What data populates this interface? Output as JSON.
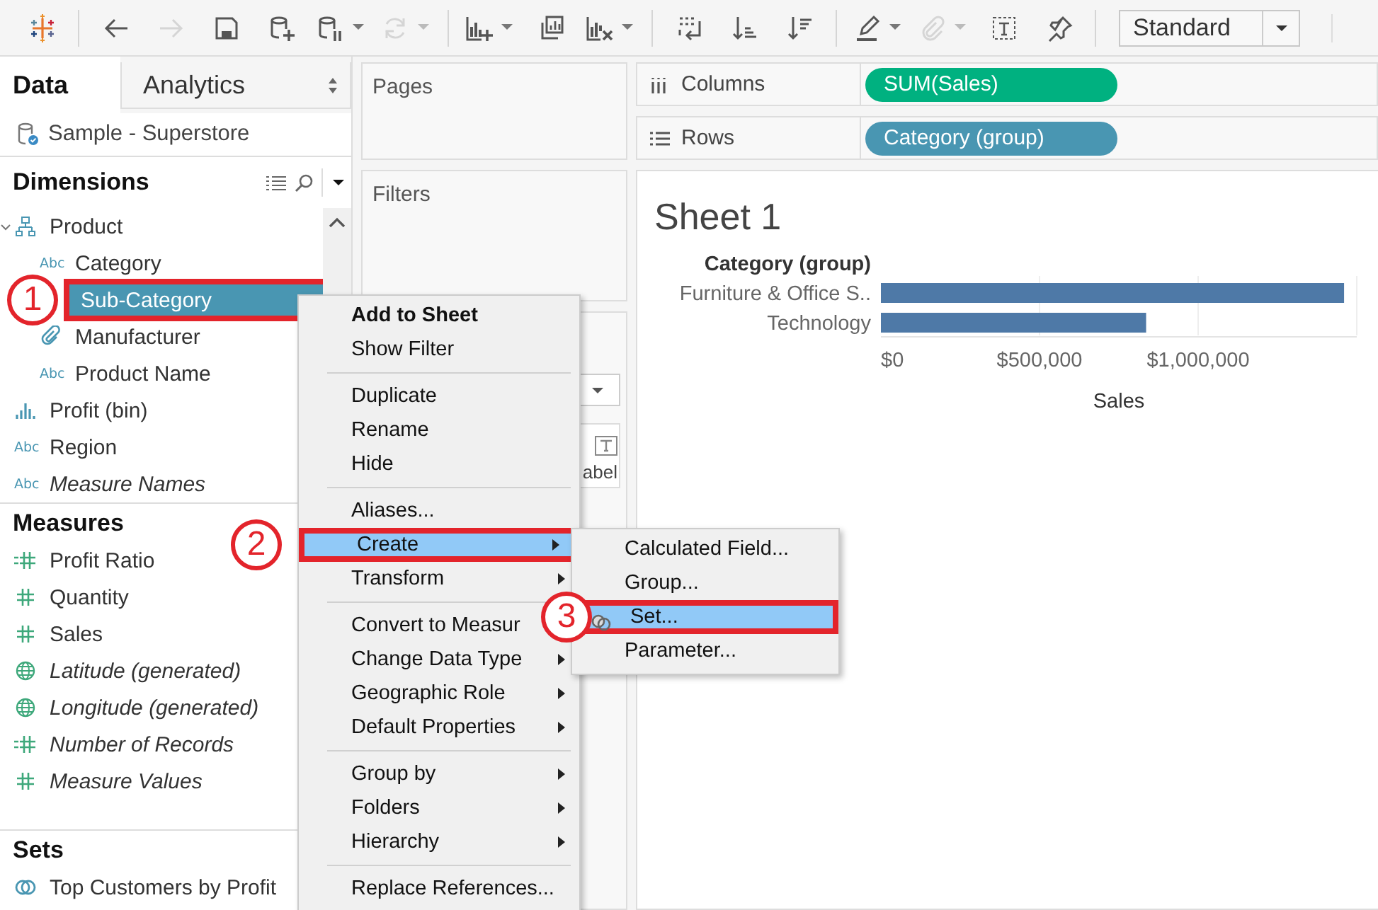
{
  "toolbar": {
    "groups": [
      [
        {
          "kind": "logo",
          "disabled": false,
          "menu": false
        }
      ],
      [
        {
          "kind": "back",
          "disabled": false,
          "menu": false
        },
        {
          "kind": "forward",
          "disabled": true,
          "menu": false
        },
        {
          "kind": "save",
          "disabled": false,
          "menu": false
        },
        {
          "kind": "add-data",
          "disabled": false,
          "menu": false
        },
        {
          "kind": "pause-data",
          "disabled": false,
          "menu": true
        },
        {
          "kind": "refresh",
          "disabled": true,
          "menu": true
        }
      ],
      [
        {
          "kind": "new-sheet",
          "disabled": false,
          "menu": true
        },
        {
          "kind": "duplicate",
          "disabled": false,
          "menu": false
        },
        {
          "kind": "clear",
          "disabled": false,
          "menu": true
        }
      ],
      [
        {
          "kind": "swap",
          "disabled": false,
          "menu": false
        },
        {
          "kind": "sort-asc",
          "disabled": false,
          "menu": false
        },
        {
          "kind": "sort-desc",
          "disabled": false,
          "menu": false
        }
      ],
      [
        {
          "kind": "highlight",
          "disabled": false,
          "menu": true
        },
        {
          "kind": "clip",
          "disabled": true,
          "menu": true
        },
        {
          "kind": "text",
          "disabled": false,
          "menu": false
        },
        {
          "kind": "pin",
          "disabled": false,
          "menu": false
        }
      ]
    ],
    "fit": "Standard"
  },
  "data_pane": {
    "tabs": [
      {
        "label": "Data",
        "selected": true
      },
      {
        "label": "Analytics",
        "selected": false
      }
    ],
    "datasource": "Sample - Superstore",
    "dimensions": {
      "title": "Dimensions",
      "fields": [
        {
          "label": "Product",
          "kind": "hierarchy",
          "italic": false,
          "selected": false,
          "expanded": true,
          "children": [
            {
              "label": "Category",
              "kind": "string",
              "badge": "Abc",
              "italic": false,
              "selected": false
            },
            {
              "label": "Sub-Category",
              "kind": "string",
              "italic": false,
              "selected": true,
              "callout": "1"
            },
            {
              "label": "Manufacturer",
              "kind": "group",
              "italic": false,
              "selected": false
            },
            {
              "label": "Product Name",
              "kind": "string",
              "badge": "Abc",
              "italic": false,
              "selected": false
            }
          ]
        },
        {
          "label": "Profit (bin)",
          "kind": "bin",
          "italic": false,
          "selected": false
        },
        {
          "label": "Region",
          "kind": "string",
          "badge": "Abc",
          "italic": false,
          "selected": false
        },
        {
          "label": "Measure Names",
          "kind": "string",
          "badge": "Abc",
          "italic": true,
          "selected": false
        }
      ]
    },
    "measures": {
      "title": "Measures",
      "fields": [
        {
          "label": "Profit Ratio",
          "kind": "calc-number",
          "italic": false,
          "selected": false
        },
        {
          "label": "Quantity",
          "kind": "number",
          "italic": false,
          "selected": false
        },
        {
          "label": "Sales",
          "kind": "number",
          "italic": false,
          "selected": false
        },
        {
          "label": "Latitude (generated)",
          "kind": "geo",
          "italic": true,
          "selected": false
        },
        {
          "label": "Longitude (generated)",
          "kind": "geo",
          "italic": true,
          "selected": false
        },
        {
          "label": "Number of Records",
          "kind": "calc-number",
          "italic": true,
          "selected": false
        },
        {
          "label": "Measure Values",
          "kind": "number",
          "italic": true,
          "selected": false
        }
      ]
    },
    "sets": {
      "title": "Sets",
      "fields": [
        {
          "label": "Top Customers by Profit",
          "kind": "set",
          "italic": false,
          "selected": false
        }
      ]
    }
  },
  "cards": {
    "pages": "Pages",
    "filters": "Filters",
    "marks_label_button": "abel"
  },
  "shelves": [
    {
      "label": "Columns",
      "kind": "columns",
      "pills": [
        {
          "label": "SUM(Sales)",
          "kind": "measure"
        }
      ]
    },
    {
      "label": "Rows",
      "kind": "rows",
      "pills": [
        {
          "label": "Category (group)",
          "kind": "dimension"
        }
      ]
    }
  ],
  "sheet": {
    "title": "Sheet 1",
    "chart_data": {
      "type": "bar",
      "orientation": "horizontal",
      "ylabel": "Category (group)",
      "xlabel": "Sales",
      "categories": [
        "Furniture & Office S..",
        "Technology"
      ],
      "series": [
        {
          "color": "#4e79a7",
          "values": [
            1460000,
            836000
          ]
        }
      ],
      "xlim": [
        0,
        1500000
      ],
      "xticks": [
        {
          "value": 0,
          "label": "$0"
        },
        {
          "value": 500000,
          "label": "$500,000"
        },
        {
          "value": 1000000,
          "label": "$1,000,000"
        }
      ]
    }
  },
  "context_menu": {
    "groups": [
      [
        {
          "label": "Add to Sheet",
          "default": true,
          "submenu": false,
          "selected": false
        },
        {
          "label": "Show Filter",
          "default": false,
          "submenu": false,
          "selected": false
        }
      ],
      [
        {
          "label": "Duplicate",
          "default": false,
          "submenu": false,
          "selected": false
        },
        {
          "label": "Rename",
          "default": false,
          "submenu": false,
          "selected": false
        },
        {
          "label": "Hide",
          "default": false,
          "submenu": false,
          "selected": false
        }
      ],
      [
        {
          "label": "Aliases...",
          "default": false,
          "submenu": false,
          "selected": false
        },
        {
          "label": "Create",
          "default": false,
          "submenu": true,
          "selected": true,
          "callout": "2"
        },
        {
          "label": "Transform",
          "default": false,
          "submenu": true,
          "selected": false
        }
      ],
      [
        {
          "label": "Convert to Measur",
          "default": false,
          "submenu": false,
          "selected": false
        },
        {
          "label": "Change Data Type",
          "default": false,
          "submenu": true,
          "selected": false
        },
        {
          "label": "Geographic Role",
          "default": false,
          "submenu": true,
          "selected": false
        },
        {
          "label": "Default Properties",
          "default": false,
          "submenu": true,
          "selected": false
        }
      ],
      [
        {
          "label": "Group by",
          "default": false,
          "submenu": true,
          "selected": false
        },
        {
          "label": "Folders",
          "default": false,
          "submenu": true,
          "selected": false
        },
        {
          "label": "Hierarchy",
          "default": false,
          "submenu": true,
          "selected": false
        }
      ],
      [
        {
          "label": "Replace References...",
          "default": false,
          "submenu": false,
          "selected": false
        }
      ]
    ]
  },
  "submenu": {
    "items": [
      {
        "label": "Calculated Field...",
        "kind": "plain",
        "selected": false
      },
      {
        "label": "Group...",
        "kind": "plain",
        "selected": false
      },
      {
        "label": "Set...",
        "kind": "set",
        "selected": true,
        "callout": "3"
      },
      {
        "label": "Parameter...",
        "kind": "plain",
        "selected": false
      }
    ]
  }
}
